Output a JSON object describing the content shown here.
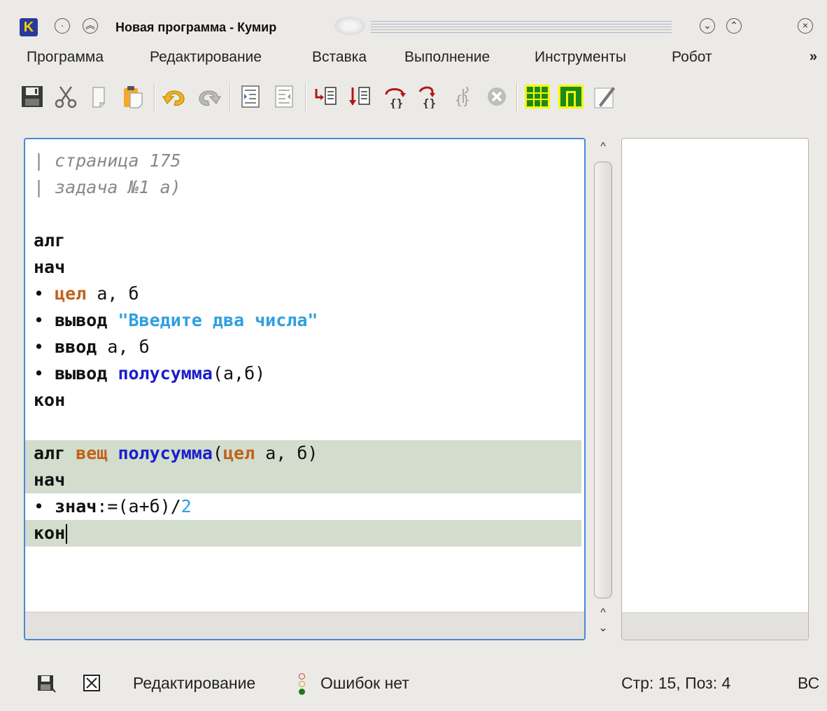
{
  "window": {
    "app_icon_letter": "K",
    "title": "Новая программа - Кумир"
  },
  "menu": {
    "items": [
      "Программа",
      "Редактирование",
      "Вставка",
      "Выполнение",
      "Инструменты",
      "Робот"
    ],
    "more": "»"
  },
  "toolbar": {
    "icons": [
      "save-icon",
      "cut-icon",
      "copy-icon",
      "paste-icon",
      "undo-icon",
      "redo-icon",
      "indent-icon",
      "unindent-icon",
      "run-icon",
      "step-icon",
      "step-into-icon",
      "step-out-icon",
      "run-to-end-icon",
      "stop-icon",
      "robot-grid-icon",
      "robot-window-icon",
      "draw-icon"
    ]
  },
  "editor": {
    "lines": [
      "| страница 175",
      "| задача №1 а)",
      "",
      "алг",
      "нач",
      "• цел а, б",
      "• вывод \"Введите два числа\"",
      "• ввод а, б",
      "• вывод полусумма(а,б)",
      "кон",
      "",
      "алг вещ полусумма(цел а, б)",
      "нач",
      "• знач:=(а+б)/2",
      "кон"
    ]
  },
  "status": {
    "mode": "Редактирование",
    "errors": "Ошибок нет",
    "position": "Стр: 15, Поз: 4",
    "insert_mode": "ВС"
  },
  "colors": {
    "keyword": "#111111",
    "type": "#c0611a",
    "string": "#2f9fe0",
    "function": "#1b1fc7",
    "comment": "#888888",
    "highlight_bg": "#d2ddcd",
    "focus_border": "#4b86d4"
  }
}
